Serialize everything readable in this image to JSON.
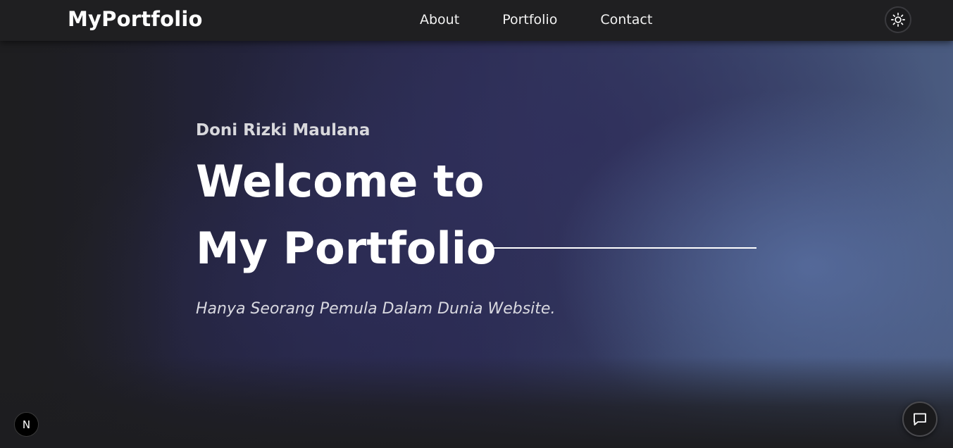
{
  "navbar": {
    "logo": "MyPortfolio",
    "links": [
      {
        "label": "About"
      },
      {
        "label": "Portfolio"
      },
      {
        "label": "Contact"
      }
    ],
    "theme_toggle_icon": "sun-icon"
  },
  "hero": {
    "name": "Doni Rizki Maulana",
    "title_line_1": "Welcome to",
    "title_line_2": "My Portfolio",
    "tagline": "Hanya Seorang Pemula Dalam Dunia Website."
  },
  "badge": {
    "letter": "N"
  },
  "chat": {
    "icon": "chat-icon"
  },
  "colors": {
    "navbar_bg": "#1f1f21",
    "text_primary": "#ffffff",
    "accent_blue": "#4a5b80",
    "accent_indigo": "#2c2d52"
  }
}
